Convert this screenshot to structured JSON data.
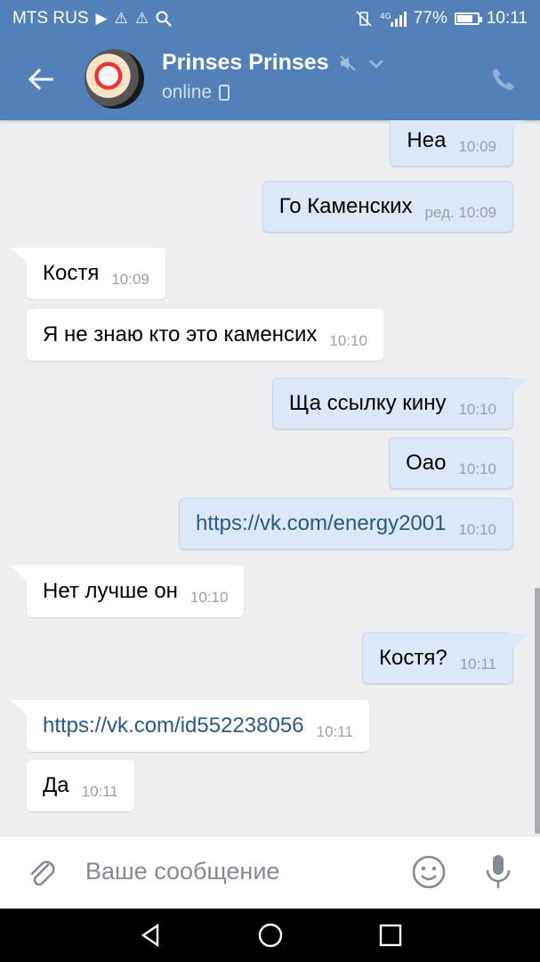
{
  "statusbar": {
    "carrier": "MTS RUS",
    "battery_percent": "77%",
    "battery_level": 0.77,
    "time": "10:11"
  },
  "header": {
    "contact_name": "Prinses Prinses",
    "presence": "online"
  },
  "messages": [
    {
      "dir": "out",
      "text": "Неа",
      "time": "10:09"
    },
    {
      "dir": "out",
      "text": "Го Каменских",
      "time": "ред. 10:09"
    },
    {
      "dir": "in",
      "text": "Костя",
      "time": "10:09"
    },
    {
      "dir": "in",
      "text": "Я не знаю кто это каменсих",
      "time": "10:10"
    },
    {
      "dir": "out",
      "text": "Ща ссылку кину",
      "time": "10:10"
    },
    {
      "dir": "out",
      "text": "Оао",
      "time": "10:10"
    },
    {
      "dir": "out",
      "text": "https://vk.com/energy2001",
      "time": "10:10",
      "is_link": true
    },
    {
      "dir": "in",
      "text": "Нет лучше он",
      "time": "10:10"
    },
    {
      "dir": "out",
      "text": "Костя?",
      "time": "10:11"
    },
    {
      "dir": "in",
      "text": "https://vk.com/id552238056",
      "time": "10:11",
      "is_link": true
    },
    {
      "dir": "in",
      "text": "Да",
      "time": "10:11"
    }
  ],
  "composer": {
    "placeholder": "Ваше сообщение"
  },
  "icons": {
    "back": "arrow-left-icon",
    "muted": "muted-speaker-icon",
    "dropdown": "chevron-down-icon",
    "mobile": "mobile-phone-icon",
    "call": "phone-call-icon",
    "attach": "paperclip-icon",
    "emoji": "smiley-icon",
    "voice": "microphone-icon"
  },
  "colors": {
    "header": "#5181b8",
    "outgoing_bubble": "#dce8f7",
    "incoming_bubble": "#ffffff",
    "link": "#2a5885",
    "chat_background": "#edeef0"
  }
}
